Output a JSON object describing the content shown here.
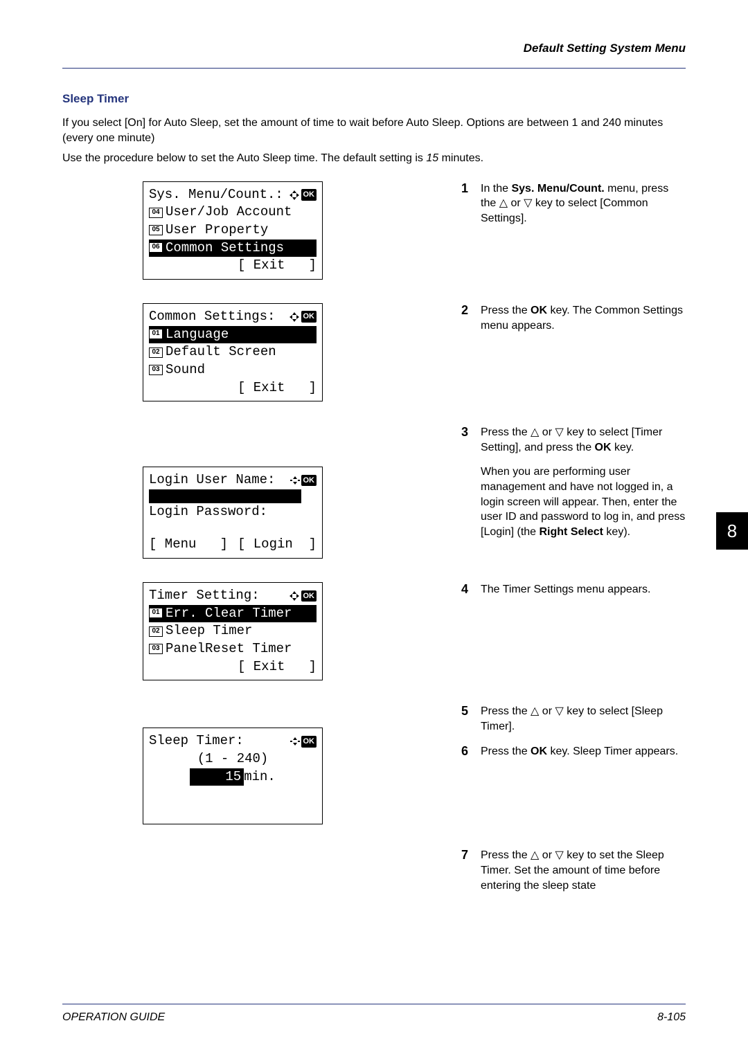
{
  "header": "Default Setting System Menu",
  "section_title": "Sleep Timer",
  "intro_para": "If you select [On] for Auto Sleep, set the amount of time to wait before Auto Sleep. Options are between 1 and 240 minutes (every one minute)",
  "proc_para_pre": "Use the procedure below to set the Auto Sleep time. The default setting is ",
  "proc_default": "15",
  "proc_para_post": " minutes.",
  "page_tab": "8",
  "footer_left": "OPERATION GUIDE",
  "footer_right": "8-105",
  "lcd1": {
    "title": "Sys. Menu/Count.:",
    "items": [
      {
        "n": "04",
        "label": "User/Job Account",
        "sel": false
      },
      {
        "n": "05",
        "label": "User Property",
        "sel": false
      },
      {
        "n": "06",
        "label": "Common Settings",
        "sel": true
      }
    ],
    "softkey": "[ Exit   ]"
  },
  "lcd2": {
    "title": "Common Settings:",
    "items": [
      {
        "n": "01",
        "label": "Language",
        "sel": true
      },
      {
        "n": "02",
        "label": "Default Screen",
        "sel": false
      },
      {
        "n": "03",
        "label": "Sound",
        "sel": false
      }
    ],
    "softkey": "[ Exit   ]"
  },
  "lcd3": {
    "title": "Login User Name:",
    "pw_label": "Login Password:",
    "left_key": "[ Menu   ]",
    "right_key": "[ Login  ]"
  },
  "lcd4": {
    "title": "Timer Setting:",
    "items": [
      {
        "n": "01",
        "label": "Err. Clear Timer",
        "sel": true
      },
      {
        "n": "02",
        "label": "Sleep Timer",
        "sel": false
      },
      {
        "n": "03",
        "label": "PanelReset Timer",
        "sel": false
      }
    ],
    "softkey": "[ Exit   ]"
  },
  "lcd5": {
    "title": "Sleep Timer:",
    "range": "(1 - 240)",
    "value": "15",
    "unit": "min."
  },
  "steps": {
    "s1a": "In the ",
    "s1b": "Sys. Menu/Count.",
    "s1c": " menu, press the ",
    "s1d": " or ",
    "s1e": " key to select [Common Settings].",
    "s2a": "Press the ",
    "s2b": "OK",
    "s2c": " key. The Common Settings menu appears.",
    "s3a": "Press the ",
    "s3b": " or ",
    "s3c": " key to select [Timer Setting], and press the ",
    "s3d": "OK",
    "s3e": " key.",
    "s3para": "When you are performing user management and have not logged in, a login screen will appear. Then, enter the user ID and password to log in, and press [Login] (the ",
    "s3para_b": "Right Select",
    "s3para_c": " key).",
    "s4": "The Timer Settings menu appears.",
    "s5a": "Press the ",
    "s5b": " or ",
    "s5c": " key to select [Sleep Timer].",
    "s6a": "Press the ",
    "s6b": "OK",
    "s6c": " key. Sleep Timer appears.",
    "s7a": "Press the ",
    "s7b": " or ",
    "s7c": " key to set the Sleep Timer. Set the amount of time before entering the sleep state"
  }
}
